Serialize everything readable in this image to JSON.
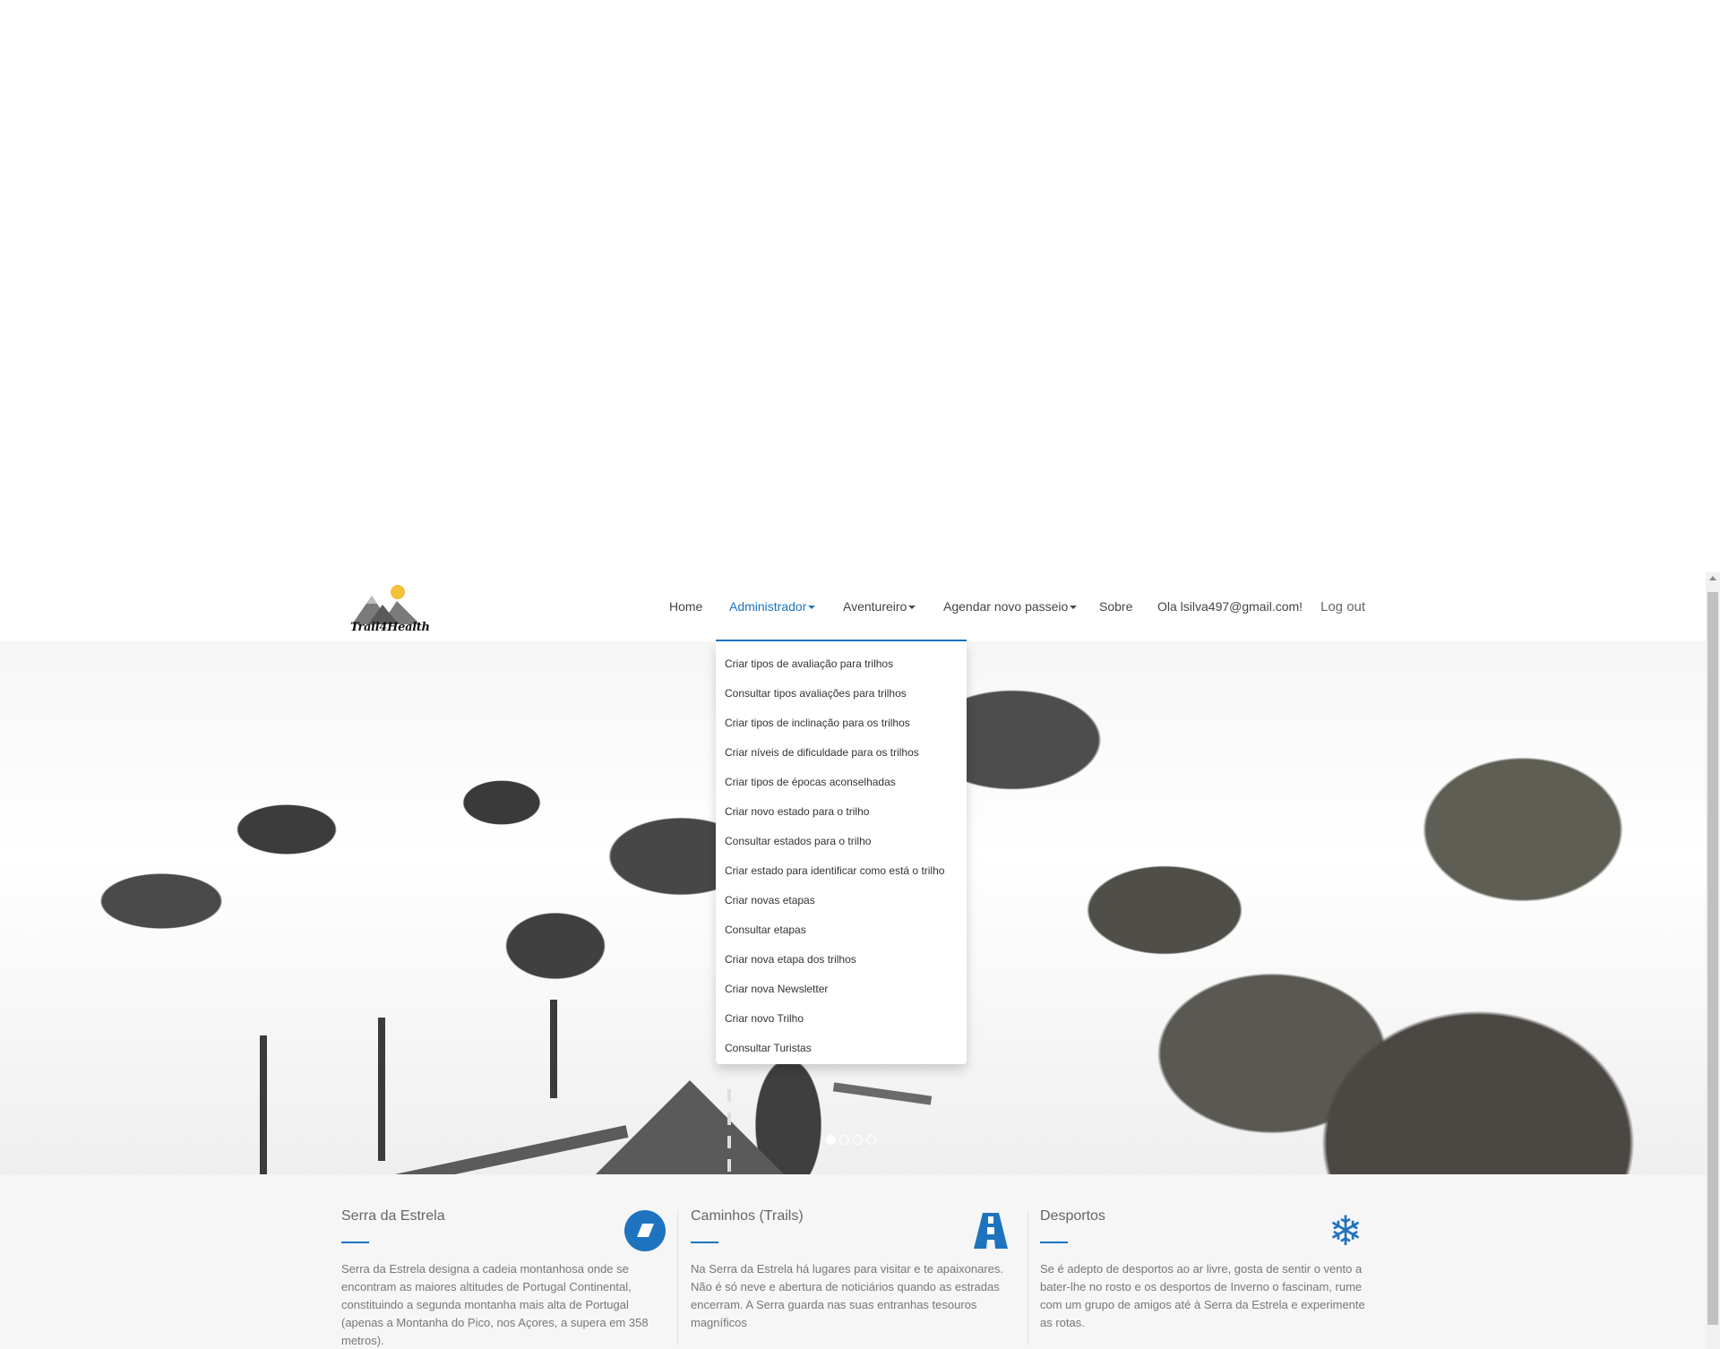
{
  "brand": {
    "logo_text": "Trail4Health"
  },
  "nav": {
    "home": "Home",
    "admin": "Administrador",
    "adventurer": "Aventureiro",
    "schedule": "Agendar novo passeio",
    "about": "Sobre",
    "greeting": "Ola lsilva497@gmail.com!",
    "logout": "Log out",
    "accent_color": "#1e73be"
  },
  "admin_menu": [
    "Criar tipos de avaliação para trilhos",
    "Consultar tipos avaliações para trilhos",
    "Criar tipos de inclinação para os trilhos",
    "Criar níveis de dificuldade para os trilhos",
    "Criar tipos de épocas aconselhadas",
    "Criar novo estado para o trilho",
    "Consultar estados para o trilho",
    "Criar estado para identificar como está o trilho",
    "Criar novas etapas",
    "Consultar etapas",
    "Criar nova etapa dos trilhos",
    "Criar nova Newsletter",
    "Criar novo Trilho",
    "Consultar Turistas"
  ],
  "carousel": {
    "slides": 4,
    "active_slide": 1,
    "prev_icon": "chevron-left-icon",
    "next_icon": "chevron-right-icon"
  },
  "features": [
    {
      "title": "Serra da Estrela",
      "icon": "diamond-badge-icon",
      "text": "Serra da Estrela designa a cadeia montanhosa onde se encontram as maiores altitudes de Portugal Continental, constituindo a segunda montanha mais alta de Portugal (apenas a Montanha do Pico, nos Açores, a supera em 358 metros)."
    },
    {
      "title": "Caminhos (Trails)",
      "icon": "road-icon",
      "text": "Na Serra da Estrela há lugares para visitar e te apaixonares. Não é só neve e abertura de noticiários quando as estradas encerram. A Serra guarda nas suas entranhas tesouros magníficos"
    },
    {
      "title": "Desportos",
      "icon": "snowflake-icon",
      "text": "Se é adepto de desportos ao ar livre, gosta de sentir o vento a bater-lhe no rosto e os desportos de Inverno o fascinam, rume com um grupo de amigos até à Serra da Estrela e experimente as rotas."
    }
  ]
}
